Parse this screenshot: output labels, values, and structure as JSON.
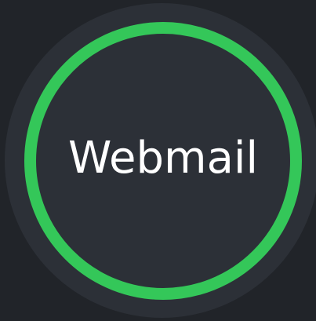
{
  "app_button": {
    "label": "Webmail",
    "icon": "webmail-app-icon",
    "status": "active"
  },
  "colors": {
    "background": "#212429",
    "disc": "#2c3037",
    "ring_accent": "#34c759",
    "label": "#ffffff"
  }
}
